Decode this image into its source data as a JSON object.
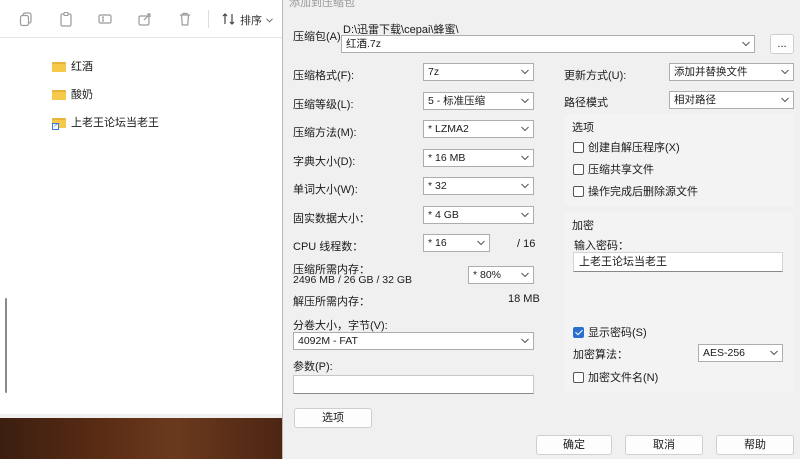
{
  "explorer": {
    "toolbar": {
      "sort_label": "排序",
      "icons": [
        "copy-icon",
        "paste-icon",
        "rename-icon",
        "share-icon",
        "delete-icon",
        "sort-icon"
      ]
    },
    "items": [
      {
        "name": "红酒",
        "icon": "folder-icon"
      },
      {
        "name": "酸奶",
        "icon": "folder-icon"
      },
      {
        "name": "上老王论坛当老王",
        "icon": "folder-shortcut-icon"
      }
    ]
  },
  "dialog": {
    "archive_label": "压缩包(A)",
    "archive_path": "D:\\迅雷下载\\cepai\\蜂蜜\\",
    "archive_name": "红酒.7z",
    "browse_label": "...",
    "left": {
      "format_label": "压缩格式(F):",
      "format_value": "7z",
      "level_label": "压缩等级(L):",
      "level_value": "5 - 标准压缩",
      "method_label": "压缩方法(M):",
      "method_value": "*  LZMA2",
      "dict_label": "字典大小(D):",
      "dict_value": "*  16 MB",
      "word_label": "单词大小(W):",
      "word_value": "*  32",
      "solid_label": "固实数据大小：",
      "solid_value": "*  4 GB",
      "cpu_label": "CPU 线程数：",
      "cpu_value": "*  16",
      "cpu_total": "/ 16",
      "mem_comp_label": "压缩所需内存：",
      "mem_comp_value": "2496 MB / 26 GB / 32 GB",
      "mem_pct": "*  80%",
      "mem_decomp_label": "解压所需内存：",
      "mem_decomp_value": "18 MB",
      "split_label": "分卷大小，字节(V):",
      "split_value": "4092M - FAT",
      "params_label": "参数(P):",
      "options_button": "选项"
    },
    "right": {
      "update_label": "更新方式(U):",
      "update_value": "添加并替换文件",
      "path_label": "路径模式",
      "path_value": "相对路径",
      "options_group": "选项",
      "opt_sfx": "创建自解压程序(X)",
      "opt_shared": "压缩共享文件",
      "opt_delete": "操作完成后删除源文件",
      "encrypt_group": "加密",
      "pwd_label": "输入密码：",
      "pwd_value": "上老王论坛当老王",
      "show_pwd": "显示密码(S)",
      "enc_method_label": "加密算法：",
      "enc_method_value": "AES-256",
      "enc_names": "加密文件名(N)"
    },
    "buttons": {
      "ok": "确定",
      "cancel": "取消",
      "help": "帮助"
    }
  }
}
